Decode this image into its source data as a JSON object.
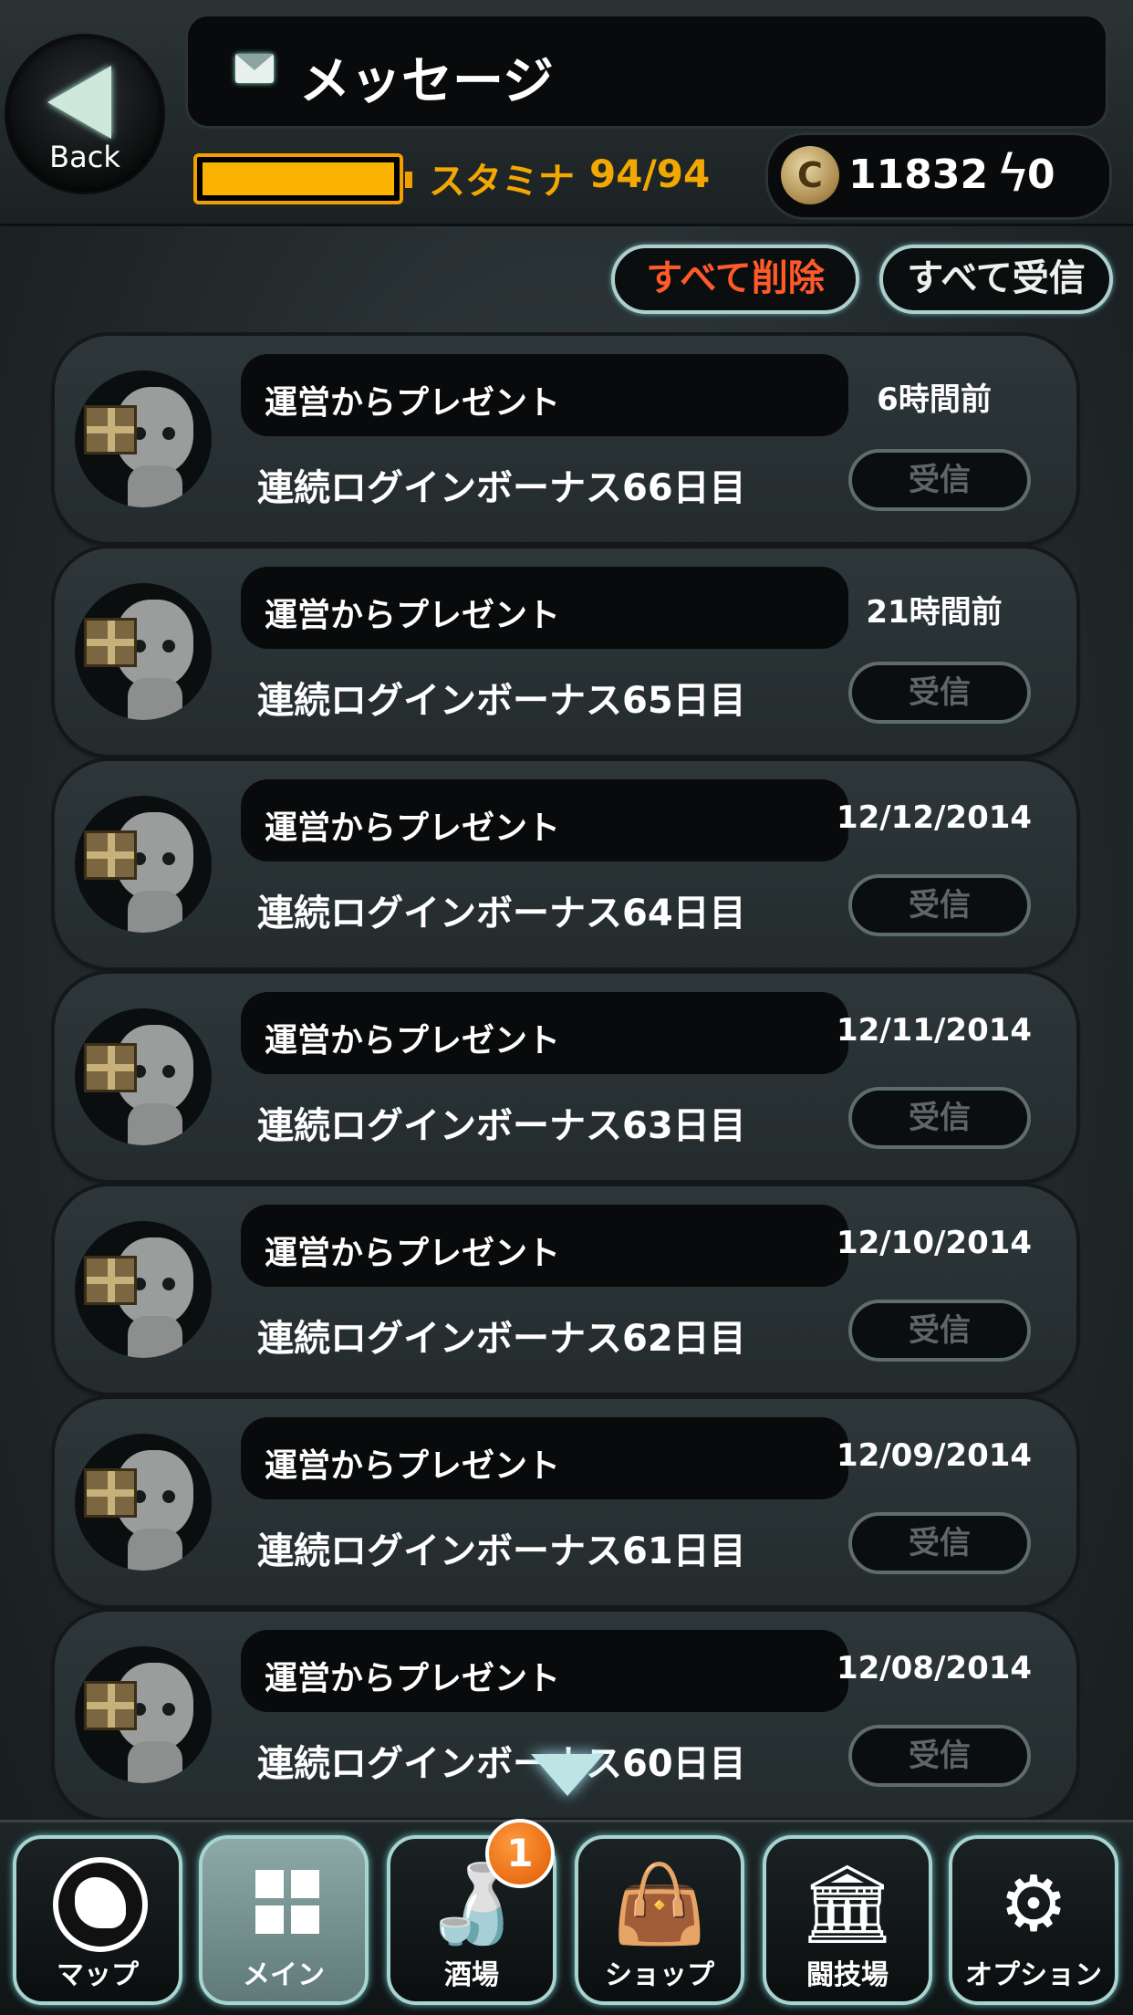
{
  "header": {
    "back_label": "Back",
    "title": "メッセージ",
    "stamina_label": "スタミナ",
    "stamina_value": "94/94",
    "stamina_fraction": 1.0,
    "coin_symbol": "C",
    "coins": "11832",
    "energy": "0"
  },
  "actions": {
    "delete_all": "すべて削除",
    "receive_all": "すべて受信"
  },
  "messages": [
    {
      "sender": "運営からプレゼント",
      "date": "6時間前",
      "body": "連続ログインボーナス66日目",
      "button": "受信"
    },
    {
      "sender": "運営からプレゼント",
      "date": "21時間前",
      "body": "連続ログインボーナス65日目",
      "button": "受信"
    },
    {
      "sender": "運営からプレゼント",
      "date": "12/12/2014",
      "body": "連続ログインボーナス64日目",
      "button": "受信"
    },
    {
      "sender": "運営からプレゼント",
      "date": "12/11/2014",
      "body": "連続ログインボーナス63日目",
      "button": "受信"
    },
    {
      "sender": "運営からプレゼント",
      "date": "12/10/2014",
      "body": "連続ログインボーナス62日目",
      "button": "受信"
    },
    {
      "sender": "運営からプレゼント",
      "date": "12/09/2014",
      "body": "連続ログインボーナス61日目",
      "button": "受信"
    },
    {
      "sender": "運営からプレゼント",
      "date": "12/08/2014",
      "body": "連続ログインボーナス60日目",
      "button": "受信"
    }
  ],
  "nav": {
    "map": "マップ",
    "main": "メイン",
    "tavern": "酒場",
    "tavern_badge": "1",
    "shop": "ショップ",
    "arena": "闘技場",
    "options": "オプション"
  }
}
